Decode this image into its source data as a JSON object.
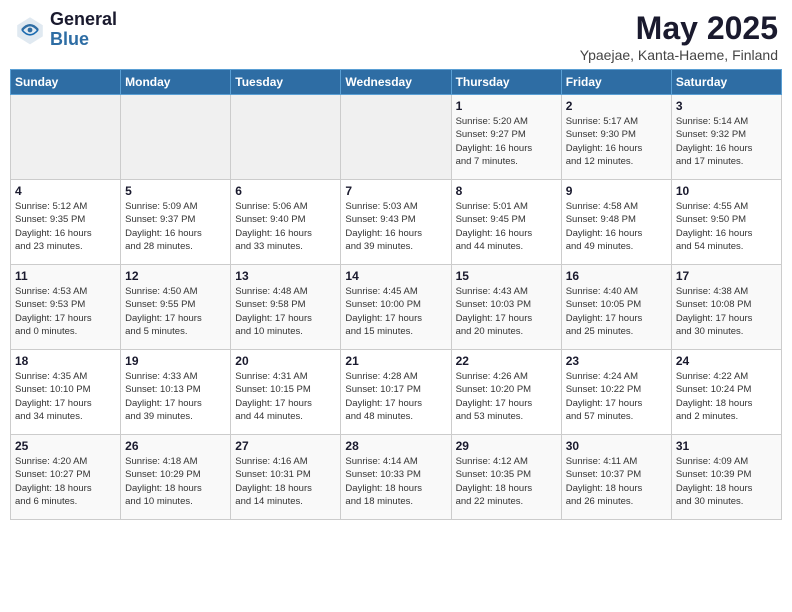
{
  "header": {
    "logo_general": "General",
    "logo_blue": "Blue",
    "title": "May 2025",
    "subtitle": "Ypaejae, Kanta-Haeme, Finland"
  },
  "weekdays": [
    "Sunday",
    "Monday",
    "Tuesday",
    "Wednesday",
    "Thursday",
    "Friday",
    "Saturday"
  ],
  "weeks": [
    [
      {
        "day": "",
        "info": ""
      },
      {
        "day": "",
        "info": ""
      },
      {
        "day": "",
        "info": ""
      },
      {
        "day": "",
        "info": ""
      },
      {
        "day": "1",
        "info": "Sunrise: 5:20 AM\nSunset: 9:27 PM\nDaylight: 16 hours\nand 7 minutes."
      },
      {
        "day": "2",
        "info": "Sunrise: 5:17 AM\nSunset: 9:30 PM\nDaylight: 16 hours\nand 12 minutes."
      },
      {
        "day": "3",
        "info": "Sunrise: 5:14 AM\nSunset: 9:32 PM\nDaylight: 16 hours\nand 17 minutes."
      }
    ],
    [
      {
        "day": "4",
        "info": "Sunrise: 5:12 AM\nSunset: 9:35 PM\nDaylight: 16 hours\nand 23 minutes."
      },
      {
        "day": "5",
        "info": "Sunrise: 5:09 AM\nSunset: 9:37 PM\nDaylight: 16 hours\nand 28 minutes."
      },
      {
        "day": "6",
        "info": "Sunrise: 5:06 AM\nSunset: 9:40 PM\nDaylight: 16 hours\nand 33 minutes."
      },
      {
        "day": "7",
        "info": "Sunrise: 5:03 AM\nSunset: 9:43 PM\nDaylight: 16 hours\nand 39 minutes."
      },
      {
        "day": "8",
        "info": "Sunrise: 5:01 AM\nSunset: 9:45 PM\nDaylight: 16 hours\nand 44 minutes."
      },
      {
        "day": "9",
        "info": "Sunrise: 4:58 AM\nSunset: 9:48 PM\nDaylight: 16 hours\nand 49 minutes."
      },
      {
        "day": "10",
        "info": "Sunrise: 4:55 AM\nSunset: 9:50 PM\nDaylight: 16 hours\nand 54 minutes."
      }
    ],
    [
      {
        "day": "11",
        "info": "Sunrise: 4:53 AM\nSunset: 9:53 PM\nDaylight: 17 hours\nand 0 minutes."
      },
      {
        "day": "12",
        "info": "Sunrise: 4:50 AM\nSunset: 9:55 PM\nDaylight: 17 hours\nand 5 minutes."
      },
      {
        "day": "13",
        "info": "Sunrise: 4:48 AM\nSunset: 9:58 PM\nDaylight: 17 hours\nand 10 minutes."
      },
      {
        "day": "14",
        "info": "Sunrise: 4:45 AM\nSunset: 10:00 PM\nDaylight: 17 hours\nand 15 minutes."
      },
      {
        "day": "15",
        "info": "Sunrise: 4:43 AM\nSunset: 10:03 PM\nDaylight: 17 hours\nand 20 minutes."
      },
      {
        "day": "16",
        "info": "Sunrise: 4:40 AM\nSunset: 10:05 PM\nDaylight: 17 hours\nand 25 minutes."
      },
      {
        "day": "17",
        "info": "Sunrise: 4:38 AM\nSunset: 10:08 PM\nDaylight: 17 hours\nand 30 minutes."
      }
    ],
    [
      {
        "day": "18",
        "info": "Sunrise: 4:35 AM\nSunset: 10:10 PM\nDaylight: 17 hours\nand 34 minutes."
      },
      {
        "day": "19",
        "info": "Sunrise: 4:33 AM\nSunset: 10:13 PM\nDaylight: 17 hours\nand 39 minutes."
      },
      {
        "day": "20",
        "info": "Sunrise: 4:31 AM\nSunset: 10:15 PM\nDaylight: 17 hours\nand 44 minutes."
      },
      {
        "day": "21",
        "info": "Sunrise: 4:28 AM\nSunset: 10:17 PM\nDaylight: 17 hours\nand 48 minutes."
      },
      {
        "day": "22",
        "info": "Sunrise: 4:26 AM\nSunset: 10:20 PM\nDaylight: 17 hours\nand 53 minutes."
      },
      {
        "day": "23",
        "info": "Sunrise: 4:24 AM\nSunset: 10:22 PM\nDaylight: 17 hours\nand 57 minutes."
      },
      {
        "day": "24",
        "info": "Sunrise: 4:22 AM\nSunset: 10:24 PM\nDaylight: 18 hours\nand 2 minutes."
      }
    ],
    [
      {
        "day": "25",
        "info": "Sunrise: 4:20 AM\nSunset: 10:27 PM\nDaylight: 18 hours\nand 6 minutes."
      },
      {
        "day": "26",
        "info": "Sunrise: 4:18 AM\nSunset: 10:29 PM\nDaylight: 18 hours\nand 10 minutes."
      },
      {
        "day": "27",
        "info": "Sunrise: 4:16 AM\nSunset: 10:31 PM\nDaylight: 18 hours\nand 14 minutes."
      },
      {
        "day": "28",
        "info": "Sunrise: 4:14 AM\nSunset: 10:33 PM\nDaylight: 18 hours\nand 18 minutes."
      },
      {
        "day": "29",
        "info": "Sunrise: 4:12 AM\nSunset: 10:35 PM\nDaylight: 18 hours\nand 22 minutes."
      },
      {
        "day": "30",
        "info": "Sunrise: 4:11 AM\nSunset: 10:37 PM\nDaylight: 18 hours\nand 26 minutes."
      },
      {
        "day": "31",
        "info": "Sunrise: 4:09 AM\nSunset: 10:39 PM\nDaylight: 18 hours\nand 30 minutes."
      }
    ]
  ]
}
